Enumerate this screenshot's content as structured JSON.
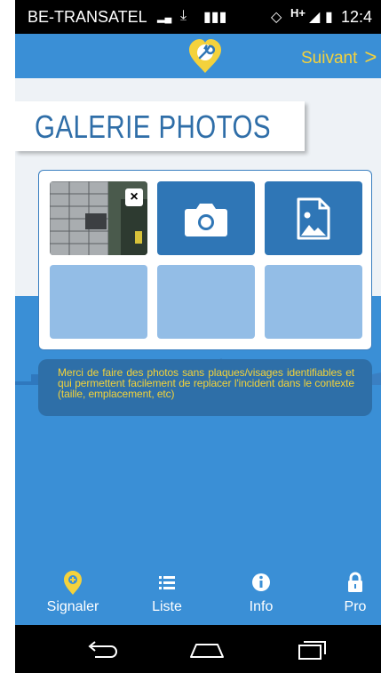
{
  "status_bar": {
    "carrier": "BE-TRANSATEL",
    "network": "H+",
    "time": "12:4"
  },
  "header": {
    "next_label": "Suivant",
    "logo_icon": "pin-wrench-logo-icon"
  },
  "gallery": {
    "title": "GALERIE PHOTOS",
    "photo_count": 1,
    "remove_label": "×"
  },
  "notice": {
    "text": "Merci de faire des photos sans plaques/visages identifiables et qui permettent facilement de replacer l'incident dans le contexte (taille, emplacement, etc)"
  },
  "tabs": [
    {
      "label": "Signaler",
      "icon": "pin-plus-icon",
      "active": true
    },
    {
      "label": "Liste",
      "icon": "list-icon",
      "active": false
    },
    {
      "label": "Info",
      "icon": "info-icon",
      "active": false
    },
    {
      "label": "Pro",
      "icon": "lock-icon",
      "active": false
    }
  ],
  "colors": {
    "primary_blue": "#3a8fd6",
    "dark_blue": "#2f76b6",
    "light_blue": "#93bde6",
    "accent_yellow": "#f4d23c"
  }
}
